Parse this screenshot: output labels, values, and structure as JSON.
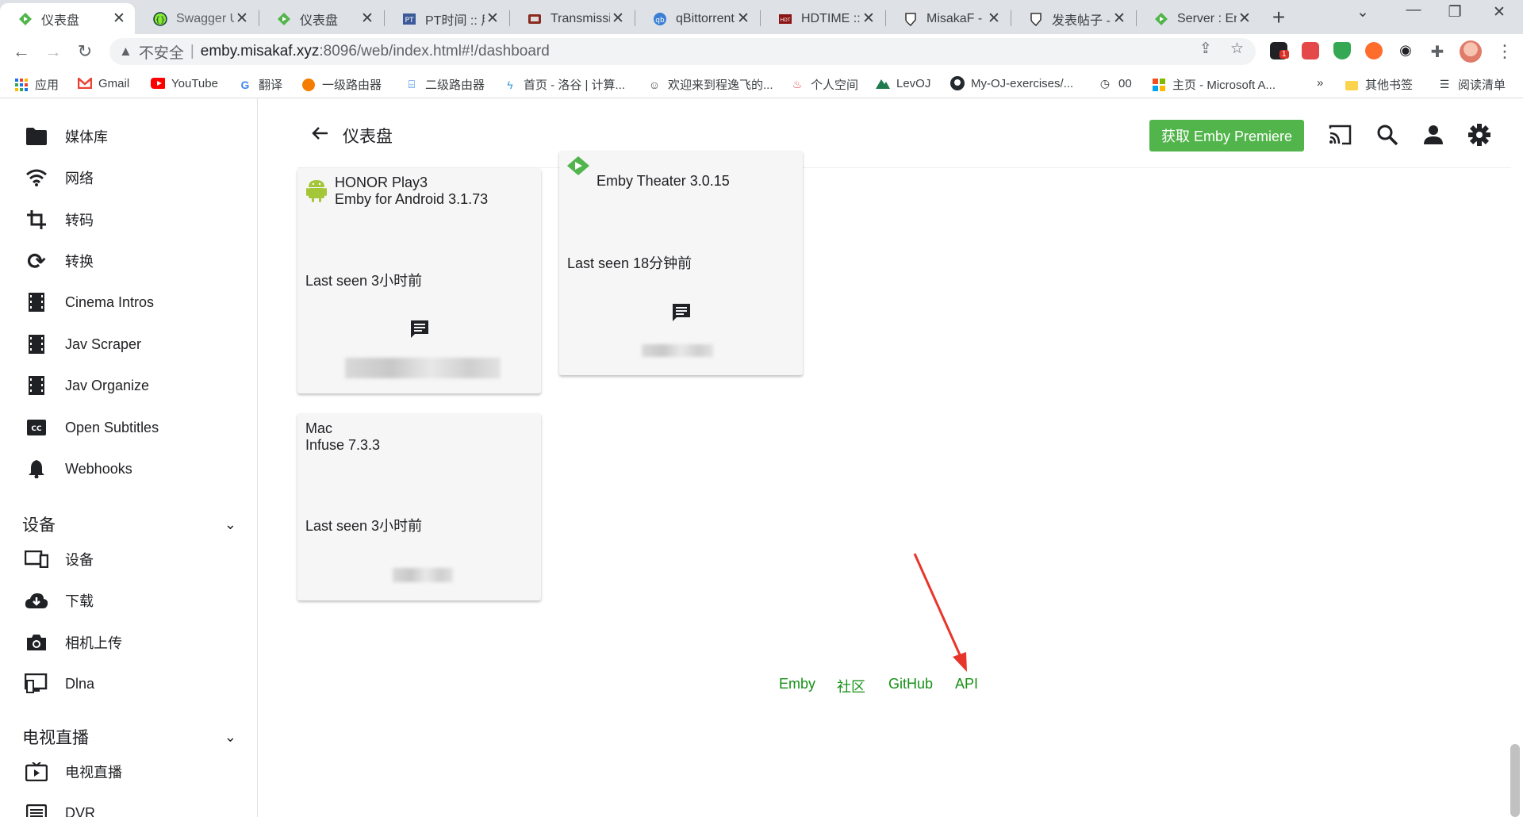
{
  "browser": {
    "tabs": [
      {
        "label": "仪表盘",
        "icon": "emby-icon",
        "active": true
      },
      {
        "label": "Swagger U",
        "icon": "swagger-icon"
      },
      {
        "label": "仪表盘",
        "icon": "emby-icon"
      },
      {
        "label": "PT时间 :: 用",
        "icon": "pt-icon"
      },
      {
        "label": "Transmissio",
        "icon": "transmission-icon"
      },
      {
        "label": "qBittorrent",
        "icon": "qbittorrent-icon"
      },
      {
        "label": "HDTIME :: ",
        "icon": "hdtime-icon"
      },
      {
        "label": "MisakaF - ",
        "icon": "misaka-icon"
      },
      {
        "label": "发表帖子 - ",
        "icon": "misaka-icon"
      },
      {
        "label": "Server : En",
        "icon": "emby-icon"
      }
    ],
    "address": {
      "security": "不安全",
      "host": "emby.misakaf.xyz",
      "path": ":8096/web/index.html#!/dashboard"
    },
    "bookmarks": [
      {
        "label": "应用",
        "icon": "apps-grid-icon"
      },
      {
        "label": "Gmail",
        "icon": "gmail-icon"
      },
      {
        "label": "YouTube",
        "icon": "youtube-icon"
      },
      {
        "label": "翻译",
        "icon": "translate-icon"
      },
      {
        "label": "一级路由器",
        "icon": "router-icon"
      },
      {
        "label": "二级路由器",
        "icon": "router2-icon"
      },
      {
        "label": "首页 - 洛谷 | 计算...",
        "icon": "luogu-icon"
      },
      {
        "label": "欢迎来到程逸飞的...",
        "icon": "person-icon"
      },
      {
        "label": "个人空间",
        "icon": "space-icon"
      },
      {
        "label": "LevOJ",
        "icon": "levoj-icon"
      },
      {
        "label": "My-OJ-exercises/...",
        "icon": "github-icon"
      },
      {
        "label": "00",
        "icon": "clock-icon"
      },
      {
        "label": "主页 - Microsoft A...",
        "icon": "microsoft-icon"
      }
    ],
    "bookmarks_more": "»",
    "other_bookmarks": "其他书签",
    "reading_list": "阅读清单",
    "extension_badge": "1"
  },
  "sidebar": {
    "items_top": [
      {
        "label": "媒体库",
        "icon": "folder-icon"
      },
      {
        "label": "网络",
        "icon": "wifi-icon"
      },
      {
        "label": "转码",
        "icon": "crop-icon"
      },
      {
        "label": "转换",
        "icon": "sync-icon"
      },
      {
        "label": "Cinema Intros",
        "icon": "film-icon"
      },
      {
        "label": "Jav Scraper",
        "icon": "film-icon"
      },
      {
        "label": "Jav Organize",
        "icon": "film-icon"
      },
      {
        "label": "Open Subtitles",
        "icon": "closed-caption-icon"
      },
      {
        "label": "Webhooks",
        "icon": "bell-icon"
      }
    ],
    "section_devices": "设备",
    "items_devices": [
      {
        "label": "设备",
        "icon": "devices-icon"
      },
      {
        "label": "下载",
        "icon": "cloud-download-icon"
      },
      {
        "label": "相机上传",
        "icon": "camera-icon"
      },
      {
        "label": "Dlna",
        "icon": "dlna-icon"
      }
    ],
    "section_livetv": "电视直播",
    "items_livetv": [
      {
        "label": "电视直播",
        "icon": "live-tv-icon"
      },
      {
        "label": "DVR",
        "icon": "list-icon"
      }
    ]
  },
  "header": {
    "title": "仪表盘",
    "premiere_button": "获取 Emby Premiere"
  },
  "devices": [
    {
      "line1": "HONOR Play3",
      "line2": "Emby for Android 3.1.73",
      "last_seen": "Last seen 3小时前",
      "icon": "android-icon"
    },
    {
      "line1": "",
      "line2": "Emby Theater 3.0.15",
      "last_seen": "Last seen 18分钟前",
      "icon": "emby-icon"
    },
    {
      "line1": "Mac",
      "line2": "Infuse 7.3.3",
      "last_seen": "Last seen 3小时前",
      "icon": ""
    }
  ],
  "footer": {
    "links": [
      "Emby",
      "社区",
      "GitHub",
      "API"
    ]
  },
  "colors": {
    "accent": "#52b54b",
    "link": "#169115",
    "annotation_arrow": "#e8352b"
  }
}
